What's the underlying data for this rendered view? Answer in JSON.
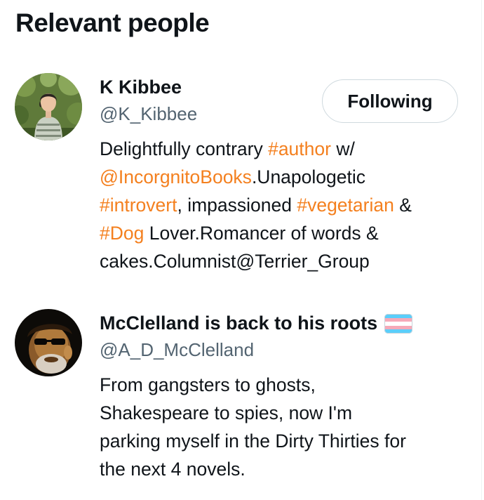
{
  "section_title": "Relevant people",
  "people": [
    {
      "name": "K Kibbee",
      "handle": "@K_Kibbee",
      "follow_label": "Following",
      "bio": {
        "line1": {
          "t1": "Delightfully contrary ",
          "l1": "#author",
          "t2": " w/"
        },
        "line2": {
          "l1": "@IncorgnitoBooks",
          "t1": ".Unapologetic"
        },
        "line3": {
          "l1": "#introvert",
          "t1": ", impassioned ",
          "l2": "#vegetarian",
          "t2": " &"
        },
        "line4": {
          "l1": "#Dog",
          "t1": " Lover.Romancer of words &"
        },
        "line5": {
          "t1": "cakes.Columnist@Terrier_Group"
        }
      },
      "avatar_icon": "person-photo-avatar"
    },
    {
      "name": "McClelland is back to his roots",
      "name_flag_icon": "transgender-flag-icon",
      "handle": "@A_D_McClelland",
      "bio": {
        "line1": "From gangsters to ghosts,",
        "line2": "Shakespeare to spies, now I'm",
        "line3": "parking myself in the Dirty Thirties for",
        "line4": "the next 4 novels."
      },
      "avatar_icon": "person-photo-avatar"
    }
  ],
  "colors": {
    "link": "#f4801f",
    "text": "#0f1419",
    "secondary": "#536471",
    "border": "#cfd9de"
  }
}
